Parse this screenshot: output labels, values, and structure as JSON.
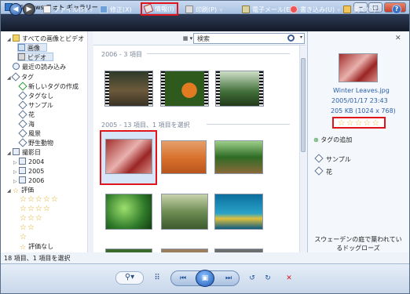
{
  "window": {
    "title": "Windows フォト ギャラリー",
    "min": "─",
    "max": "□",
    "close": "✕"
  },
  "toolbar": {
    "back": "◀",
    "forward": "▶",
    "file": "ファイル(F)",
    "fix": "修正(X)",
    "info": "情報(I)",
    "print": "印刷(P)",
    "email": "電子メール(E)",
    "burn": "書き込み(U)",
    "open": "開く(O)",
    "help": "?"
  },
  "sidebar": {
    "items": [
      {
        "label": "すべての画像とビデオ",
        "exp": "◢"
      },
      {
        "label": "画像"
      },
      {
        "label": "ビデオ"
      },
      {
        "label": "最近の読み込み"
      },
      {
        "label": "タグ",
        "exp": "◢"
      },
      {
        "label": "新しいタグの作成"
      },
      {
        "label": "タグなし"
      },
      {
        "label": "サンプル"
      },
      {
        "label": "花"
      },
      {
        "label": "海"
      },
      {
        "label": "風景"
      },
      {
        "label": "野生動物"
      },
      {
        "label": "撮影日",
        "exp": "◢"
      },
      {
        "label": "2004",
        "exp": "▷"
      },
      {
        "label": "2005",
        "exp": "▷"
      },
      {
        "label": "2006",
        "exp": "▷"
      },
      {
        "label": "評価",
        "exp": "◢"
      },
      {
        "label": "評価なし"
      }
    ],
    "rating_rows": [
      "☆☆☆☆☆",
      "☆☆☆☆",
      "☆☆☆",
      "☆☆",
      "☆"
    ],
    "status": "18 項目、1 項目を選択"
  },
  "search": {
    "sort": "▦ ▾",
    "placeholder": "検索",
    "dropdown": "▾"
  },
  "groups": [
    {
      "label": "2006 - 3 項目"
    },
    {
      "label": "2005 - 13 項目、1 項目を選択"
    }
  ],
  "info": {
    "close": "✕",
    "filename": "Winter Leaves.jpg",
    "datetime": "2005/01/17   23:43",
    "size": "205 KB (1024 x 768)",
    "rating": "☆☆☆☆☆",
    "add_tag": "タグの追加",
    "tags": [
      "サンプル",
      "花"
    ],
    "caption": "スウェーデンの庭で葉われているドッグローズ"
  },
  "bottom": {
    "zoom": "⚲▾",
    "grid": "⠿",
    "prev": "⏮",
    "play": "▣",
    "next": "⏭",
    "rotate_ccw": "↺",
    "rotate_cw": "↻",
    "delete": "✕"
  }
}
